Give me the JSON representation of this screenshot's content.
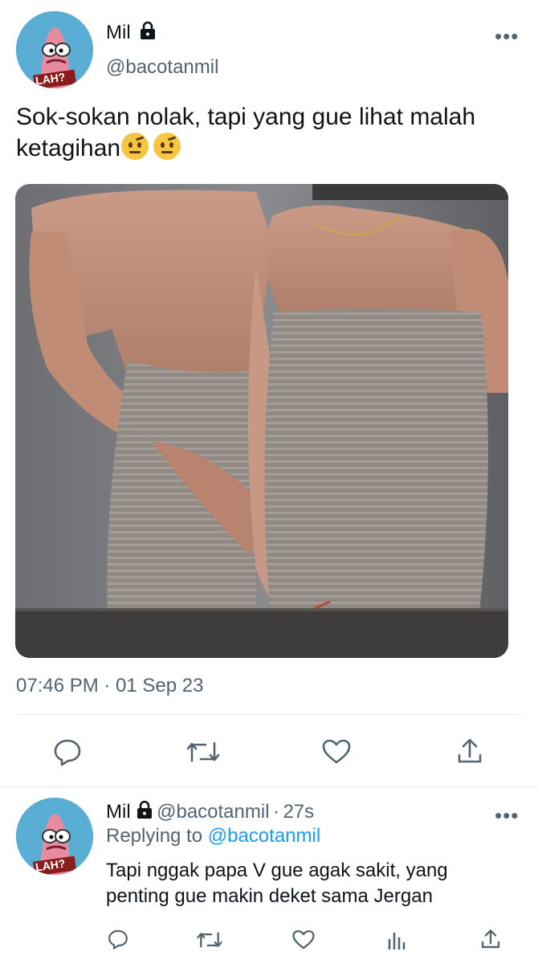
{
  "tweet": {
    "author": {
      "name": "Mil",
      "handle": "@bacotanmil",
      "avatar_text": "LAH?"
    },
    "text": "Sok-sokan nolak, tapi yang gue lihat malah ketagihan",
    "emojis": [
      "face-with-raised-eyebrow",
      "face-with-raised-eyebrow"
    ],
    "timestamp": "07:46 PM · 01 Sep 23",
    "actions": [
      "reply-icon",
      "retweet-icon",
      "like-icon",
      "share-icon"
    ]
  },
  "reply": {
    "author": {
      "name": "Mil",
      "handle": "@bacotanmil",
      "separator": "·",
      "time": "27s",
      "avatar_text": "LAH?"
    },
    "replying_prefix": "Replying to",
    "replying_to": "@bacotanmil",
    "text_line1": "Tapi nggak papa V gue agak sakit, yang",
    "text_line2": "penting gue makin deket sama Jergan",
    "actions": [
      "reply-icon",
      "retweet-icon",
      "like-icon",
      "analytics-icon",
      "share-icon"
    ]
  },
  "colors": {
    "accent": "#1d9bf0",
    "secondary_text": "#536471",
    "primary_text": "#0f1419"
  }
}
